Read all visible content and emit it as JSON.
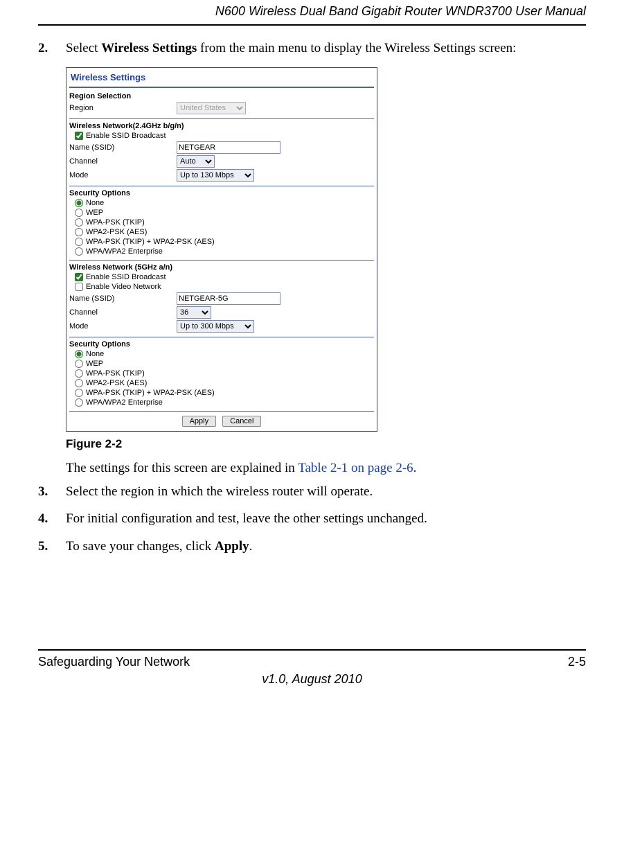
{
  "header": {
    "doc_title": "N600 Wireless Dual Band Gigabit Router WNDR3700 User Manual"
  },
  "steps": {
    "s2": {
      "num": "2.",
      "pre": "Select ",
      "bold": "Wireless Settings",
      "post": " from the main menu to display the Wireless Settings screen:"
    },
    "s2_cont_pre": "The settings for this screen are explained in ",
    "s2_cont_link": "Table 2-1 on page 2-6",
    "s2_cont_post": ".",
    "s3": {
      "num": "3.",
      "text": "Select the region in which the wireless router will operate."
    },
    "s4": {
      "num": "4.",
      "text": "For initial configuration and test, leave the other settings unchanged."
    },
    "s5": {
      "num": "5.",
      "pre": "To save your changes, click ",
      "bold": "Apply",
      "post": "."
    }
  },
  "figure_caption": "Figure 2-2",
  "screenshot": {
    "title": "Wireless Settings",
    "region_section": "Region Selection",
    "region_label": "Region",
    "region_value": "United States",
    "net24_heading": "Wireless Network(2.4GHz b/g/n)",
    "enable_ssid": "Enable SSID Broadcast",
    "name_label": "Name (SSID)",
    "name24_value": "NETGEAR",
    "channel_label": "Channel",
    "channel24_value": "Auto",
    "mode_label": "Mode",
    "mode24_value": "Up to 130 Mbps",
    "security_heading": "Security Options",
    "sec_opts": {
      "none": "None",
      "wep": "WEP",
      "wpa_psk_tkip": "WPA-PSK (TKIP)",
      "wpa2_psk_aes": "WPA2-PSK (AES)",
      "wpa_mixed": "WPA-PSK (TKIP) + WPA2-PSK (AES)",
      "enterprise": "WPA/WPA2 Enterprise"
    },
    "net5_heading": "Wireless Network (5GHz a/n)",
    "enable_video": "Enable Video Network",
    "name5_value": "NETGEAR-5G",
    "channel5_value": "36",
    "mode5_value": "Up to 300 Mbps",
    "apply_btn": "Apply",
    "cancel_btn": "Cancel"
  },
  "footer": {
    "section": "Safeguarding Your Network",
    "page": "2-5",
    "version": "v1.0, August 2010"
  }
}
